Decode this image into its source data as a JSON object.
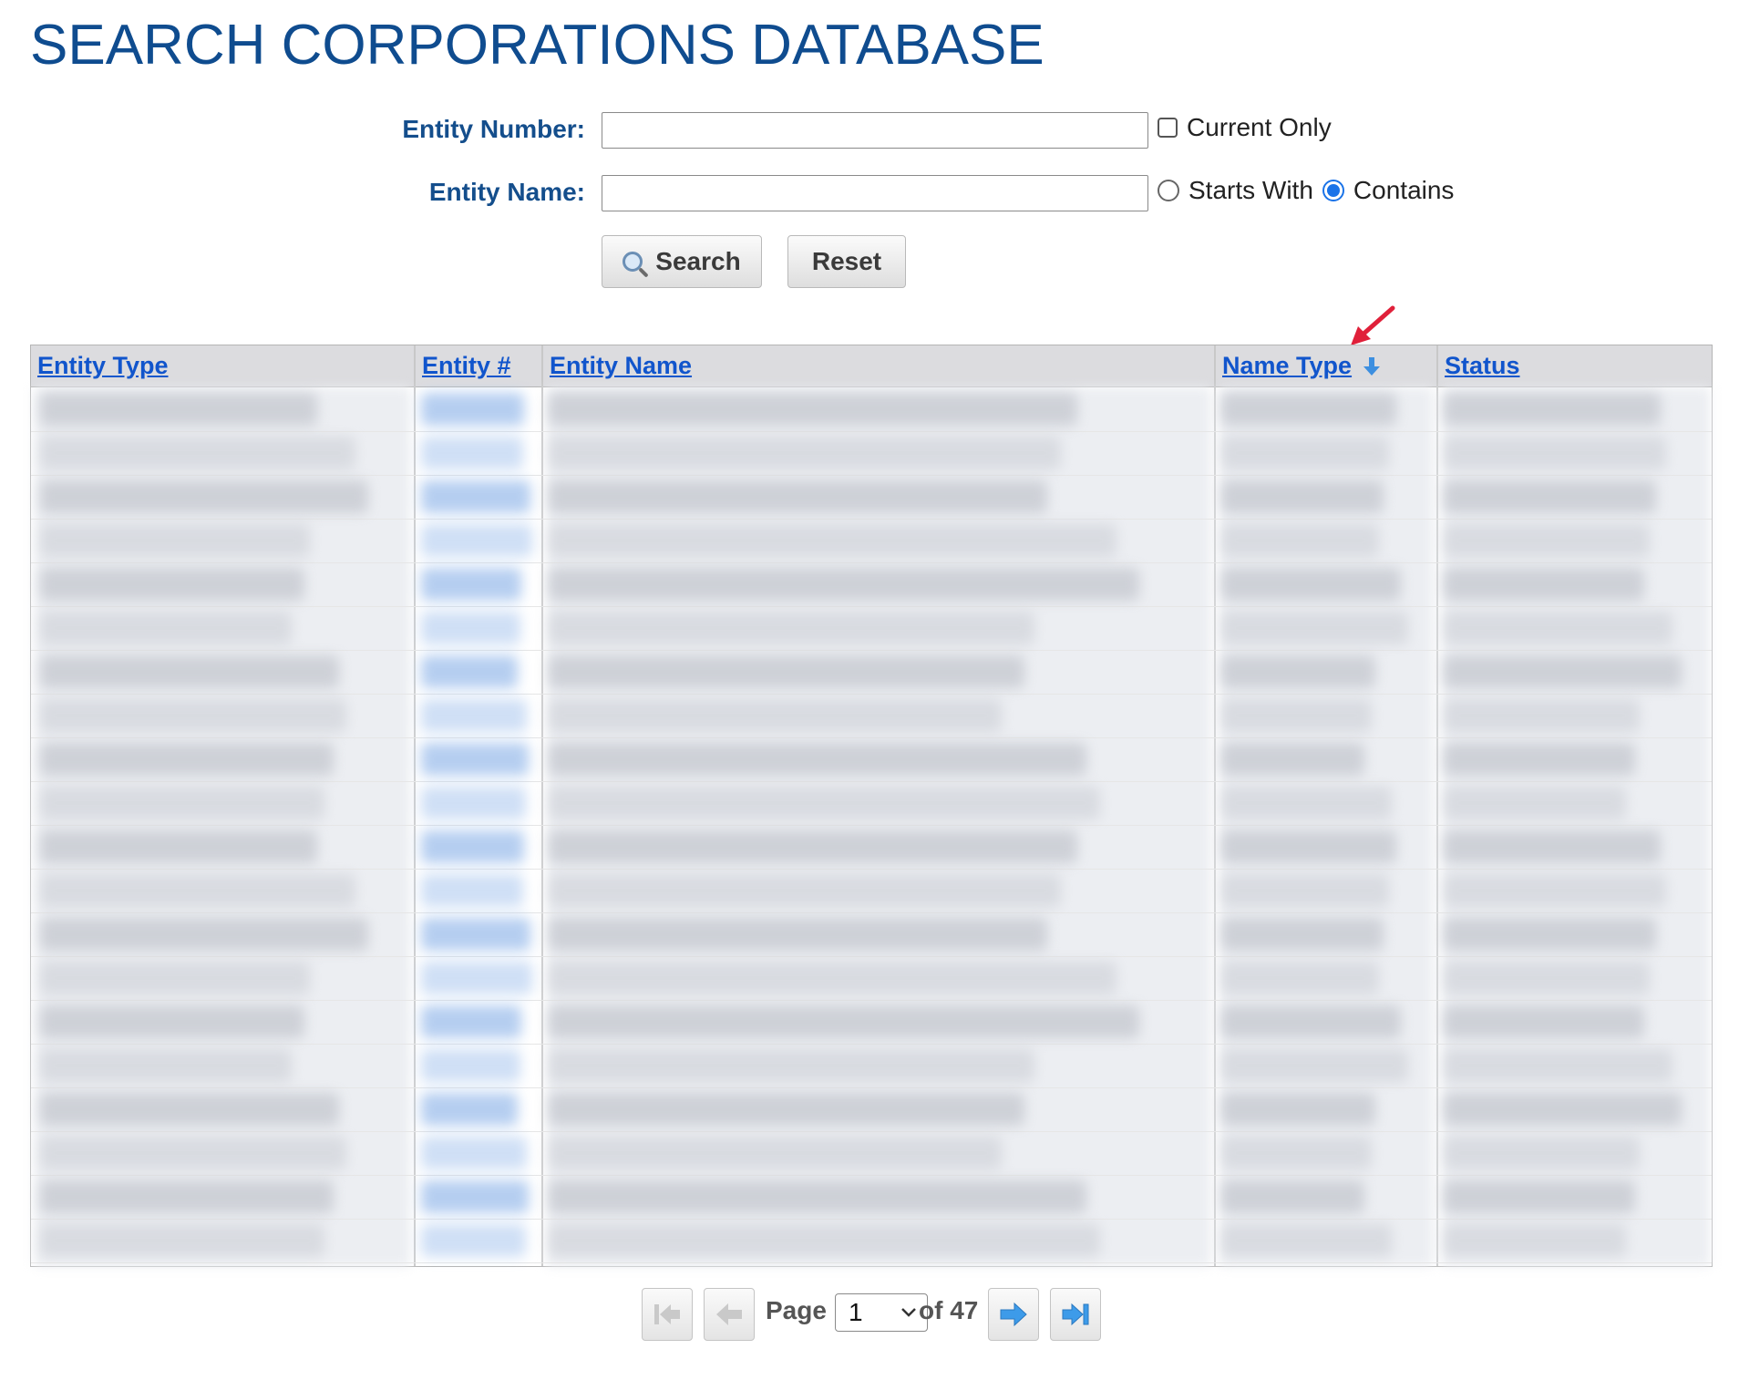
{
  "page": {
    "title": "SEARCH CORPORATIONS DATABASE"
  },
  "search_form": {
    "entity_number_label": "Entity Number:",
    "entity_number_value": "",
    "current_only_label": "Current Only",
    "current_only_checked": false,
    "entity_name_label": "Entity Name:",
    "entity_name_value": "",
    "match_options": [
      {
        "label": "Starts With",
        "selected": false
      },
      {
        "label": "Contains",
        "selected": true
      }
    ],
    "search_label": "Search",
    "reset_label": "Reset"
  },
  "results_table": {
    "columns": [
      "Entity Type",
      "Entity #",
      "Entity Name",
      "Name Type",
      "Status"
    ],
    "sorted_by": "Name Type",
    "sort_direction": "descending",
    "rows_visible": 20,
    "rows_blurred": true
  },
  "pager": {
    "page_label": "Page",
    "current_page": "1",
    "of_label": "of 47",
    "total_pages": 47
  },
  "icons": {
    "search_button": "magnifier-icon",
    "sort": "down-arrow-icon",
    "first": "first-page-icon",
    "prev": "prev-page-icon",
    "next": "next-page-icon",
    "last": "last-page-icon",
    "annotation": "red-annotation-arrow-icon"
  },
  "colors": {
    "title": "#0f4c8f",
    "label": "#144e8c",
    "link": "#1155cc",
    "annotation": "#e0203a",
    "pager_arrow": "#3d9be9"
  }
}
